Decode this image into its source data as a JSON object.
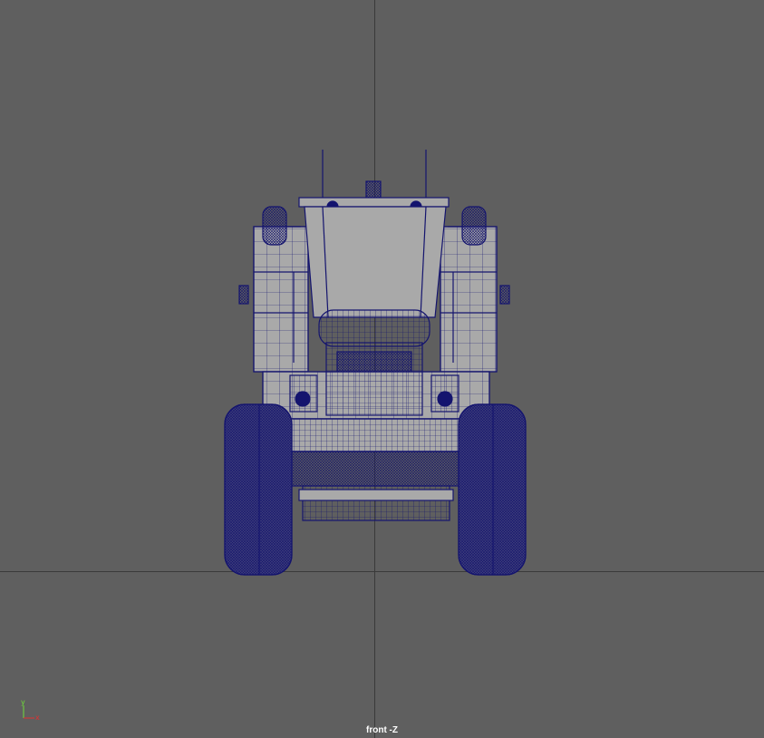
{
  "viewport": {
    "camera_label": "front -Z",
    "background_color": "#5f5f5f",
    "grid_color": "#3a3a3a",
    "wire_color": "#14146e",
    "shade_color": "#a9a9a9"
  },
  "axis_gizmo": {
    "y_label": "y",
    "x_label": "x",
    "y_color": "#6fdc3a",
    "x_color": "#e03030",
    "icon": "axis-gizmo-icon"
  },
  "model": {
    "icon": "wireframe-truck-icon"
  }
}
